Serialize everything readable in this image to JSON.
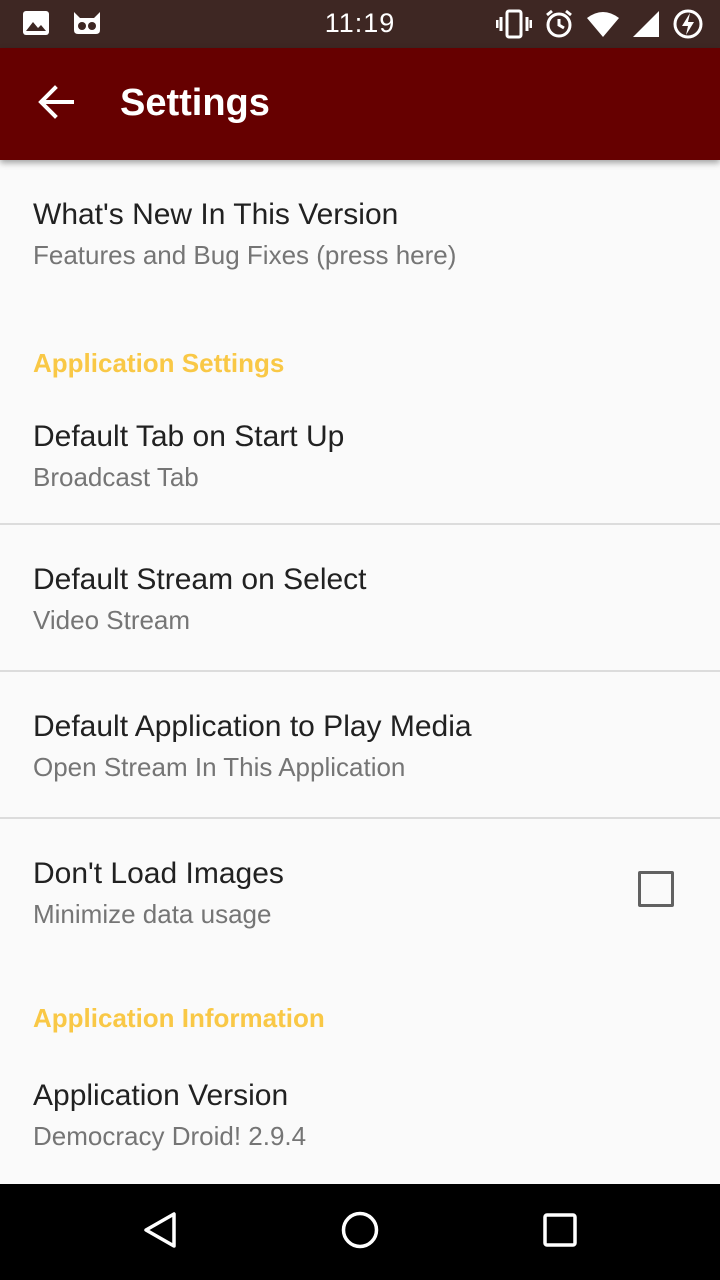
{
  "status_bar": {
    "time": "11:19",
    "left_icons": [
      "image-icon",
      "cyanogen-icon"
    ],
    "right_icons": [
      "vibrate-icon",
      "alarm-icon",
      "wifi-icon",
      "signal-icon",
      "battery-charging-icon"
    ]
  },
  "app_bar": {
    "title": "Settings",
    "back_icon": "arrow-back-icon",
    "color": "#660000"
  },
  "preferences": {
    "whats_new": {
      "title": "What's New In This Version",
      "summary": "Features and Bug Fixes (press here)"
    },
    "category_app_settings": "Application Settings",
    "default_tab": {
      "title": "Default Tab on Start Up",
      "summary": "Broadcast Tab"
    },
    "default_stream": {
      "title": "Default Stream on Select",
      "summary": "Video Stream"
    },
    "default_app": {
      "title": "Default Application to Play Media",
      "summary": "Open Stream In This Application"
    },
    "dont_load_images": {
      "title": "Don't Load Images",
      "summary": "Minimize data usage",
      "checked": false
    },
    "category_app_info": "Application Information",
    "app_version": {
      "title": "Application Version",
      "summary": "Democracy Droid! 2.9.4"
    }
  },
  "accent_color": "#f9c846",
  "nav_bar": {
    "icons": [
      "back-triangle-icon",
      "home-circle-icon",
      "recents-square-icon"
    ]
  }
}
